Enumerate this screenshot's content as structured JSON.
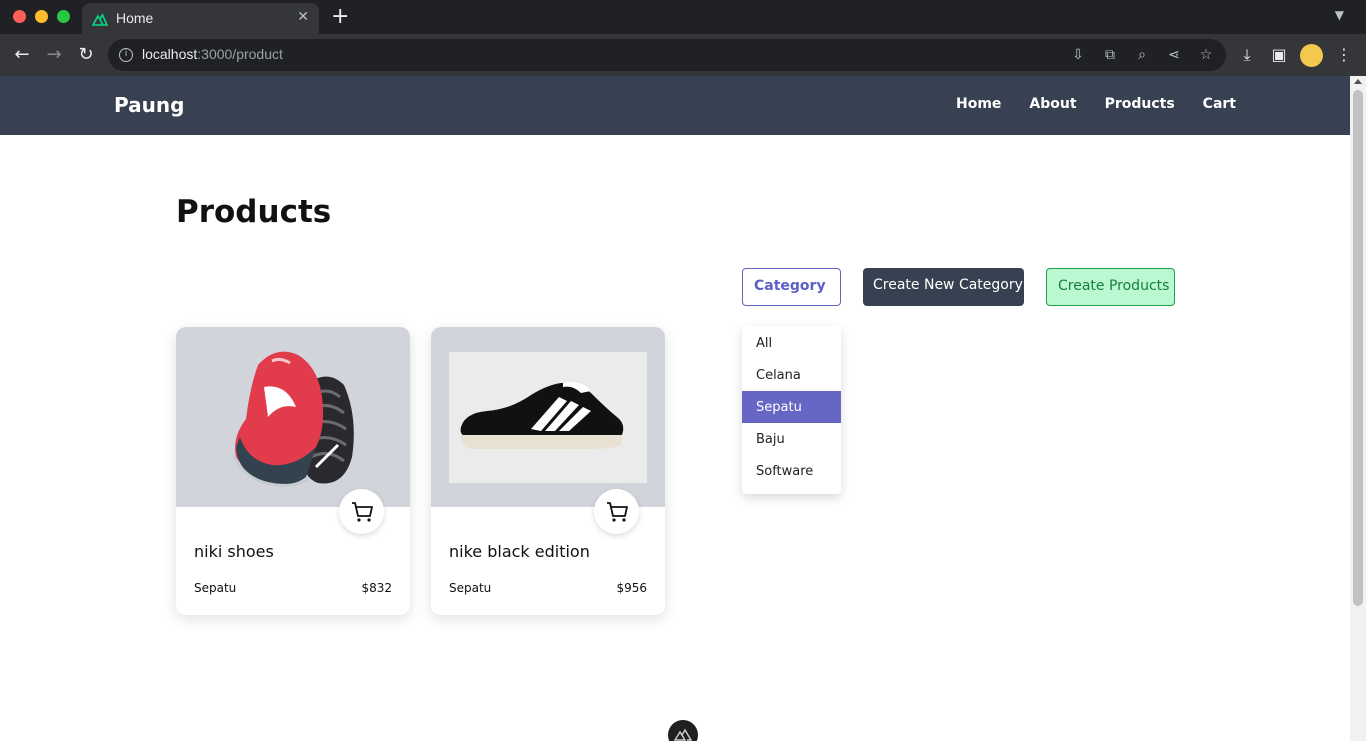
{
  "browser": {
    "tab_title": "Home",
    "url_host": "localhost",
    "url_rest": ":3000/product"
  },
  "navbar": {
    "brand": "Paung",
    "links": [
      "Home",
      "About",
      "Products",
      "Cart"
    ]
  },
  "main": {
    "heading": "Products",
    "category_button": "Category",
    "create_category_button": "Create New Category",
    "create_products_button": "Create Products",
    "category_options": [
      "All",
      "Celana",
      "Sepatu",
      "Baju",
      "Software"
    ],
    "selected_category": "Sepatu"
  },
  "products": [
    {
      "name": "niki shoes",
      "category": "Sepatu",
      "price": "$832"
    },
    {
      "name": "nike black edition",
      "category": "Sepatu",
      "price": "$956"
    }
  ],
  "colors": {
    "navbar_bg": "#374151",
    "accent_purple": "#6666c4",
    "create_products_bg": "#bbf7d0",
    "card_image_bg": "#d1d5db"
  }
}
